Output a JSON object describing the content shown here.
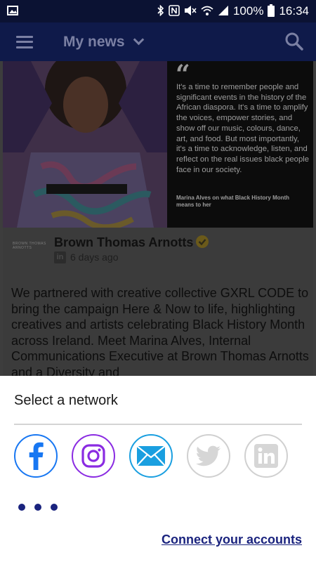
{
  "status_bar": {
    "battery": "100%",
    "time": "16:34",
    "icons": [
      "image-icon",
      "bluetooth-icon",
      "nfc-icon",
      "mute-icon",
      "wifi-icon",
      "signal-icon",
      "battery-icon"
    ]
  },
  "app_bar": {
    "title": "My news",
    "menu_icon": "hamburger-icon",
    "search_icon": "search-icon",
    "dropdown_icon": "chevron-down-icon"
  },
  "post": {
    "quote": "It's a time to remember people and significant events in the history of the African diaspora. It's a time to amplify the voices, empower stories, and show off our music, colours, dance, art, and food. But most importantly, it's a time to acknowledge, listen, and reflect on the real issues black people face in our society.",
    "quote_attribution": "Marina Alves on what Black History Month means to her",
    "author_logo_text": "BROWN THOMAS ARNOTTS",
    "author": "Brown Thomas Arnotts",
    "network_badge": "in",
    "time": "6 days ago",
    "text": "We partnered with creative collective GXRL CODE to bring the campaign Here & Now to life, highlighting creatives and artists celebrating Black History Month across Ireland.   Meet Marina Alves, Internal Communications Executive at Brown Thomas Arnotts and a Diversity and"
  },
  "sheet": {
    "title": "Select a network",
    "networks": [
      {
        "name": "facebook",
        "color": "#1877f2",
        "enabled": true
      },
      {
        "name": "instagram",
        "color": "#8a2be2",
        "enabled": true
      },
      {
        "name": "email",
        "color": "#1a9fe0",
        "enabled": true
      },
      {
        "name": "twitter",
        "color": "#c9c9c9",
        "enabled": false
      },
      {
        "name": "linkedin",
        "color": "#c9c9c9",
        "enabled": false
      }
    ],
    "connect_label": "Connect your accounts"
  },
  "colors": {
    "app_bar": "#0f1a4a",
    "status_bar": "#0b1233",
    "accent": "#1a237e"
  }
}
